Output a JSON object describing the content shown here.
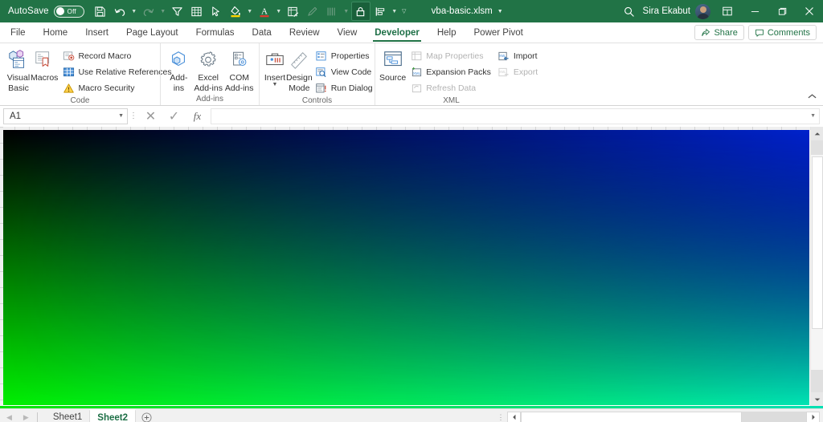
{
  "titlebar": {
    "autosave_label": "AutoSave",
    "autosave_state": "Off",
    "document_name": "vba-basic.xlsm",
    "user_name": "Sira Ekabut",
    "qat": [
      {
        "name": "save-icon",
        "label": "Save"
      },
      {
        "name": "undo-icon",
        "label": "Undo"
      },
      {
        "name": "redo-icon",
        "label": "Redo"
      },
      {
        "name": "filter-icon",
        "label": "Filter"
      },
      {
        "name": "table-icon",
        "label": "Format as Table"
      },
      {
        "name": "pointer-icon",
        "label": "Select Objects"
      },
      {
        "name": "fill-color-icon",
        "label": "Fill Color"
      },
      {
        "name": "font-color-icon",
        "label": "Font Color"
      },
      {
        "name": "format-icon",
        "label": "Format Cells"
      },
      {
        "name": "pencil-icon",
        "label": "Draw"
      },
      {
        "name": "columns-icon",
        "label": "Columns"
      },
      {
        "name": "lock-icon",
        "label": "Lock Cell"
      },
      {
        "name": "align-icon",
        "label": "Align"
      }
    ],
    "window": {
      "minimize": "─",
      "restore": "❐",
      "close": "✕"
    }
  },
  "tabs": {
    "items": [
      {
        "label": "File",
        "active": false
      },
      {
        "label": "Home",
        "active": false
      },
      {
        "label": "Insert",
        "active": false
      },
      {
        "label": "Page Layout",
        "active": false
      },
      {
        "label": "Formulas",
        "active": false
      },
      {
        "label": "Data",
        "active": false
      },
      {
        "label": "Review",
        "active": false
      },
      {
        "label": "View",
        "active": false
      },
      {
        "label": "Developer",
        "active": true
      },
      {
        "label": "Help",
        "active": false
      },
      {
        "label": "Power Pivot",
        "active": false
      }
    ],
    "share_label": "Share",
    "comments_label": "Comments"
  },
  "ribbon": {
    "code": {
      "group_label": "Code",
      "visual_basic": "Visual\nBasic",
      "visual_basic_line1": "Visual",
      "visual_basic_line2": "Basic",
      "macros": "Macros",
      "record_macro": "Record Macro",
      "use_relative_references": "Use Relative References",
      "macro_security": "Macro Security"
    },
    "addins": {
      "group_label": "Add-ins",
      "addins_line1": "Add-",
      "addins_line2": "ins",
      "excel_line1": "Excel",
      "excel_line2": "Add-ins",
      "com_line1": "COM",
      "com_line2": "Add-ins"
    },
    "controls": {
      "group_label": "Controls",
      "insert": "Insert",
      "design_line1": "Design",
      "design_line2": "Mode",
      "properties": "Properties",
      "view_code": "View Code",
      "run_dialog": "Run Dialog"
    },
    "xml": {
      "group_label": "XML",
      "source": "Source",
      "map_properties": "Map Properties",
      "expansion_packs": "Expansion Packs",
      "refresh_data": "Refresh Data",
      "import": "Import",
      "export": "Export"
    }
  },
  "formula_bar": {
    "name_box_value": "A1",
    "cancel_icon": "✕",
    "enter_icon": "✓",
    "function_icon": "fx",
    "formula_value": "",
    "formula_placeholder": ""
  },
  "sheet_tabs": {
    "sheets": [
      {
        "label": "Sheet1",
        "active": false
      },
      {
        "label": "Sheet2",
        "active": true
      }
    ],
    "add_sheet_icon": "+"
  },
  "canvas": {
    "description": "gradient-image",
    "corner_colors": {
      "top_left": "#000a00",
      "top_right": "#0022cc",
      "bottom_left": "#00ee00",
      "bottom_right": "#00e4b4"
    }
  }
}
